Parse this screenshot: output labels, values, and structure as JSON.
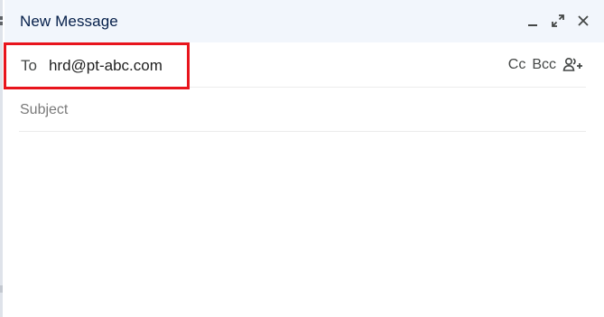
{
  "compose": {
    "title": "New Message",
    "to_label": "To",
    "to_value": "hrd@pt-abc.com",
    "cc_label": "Cc",
    "bcc_label": "Bcc",
    "subject_placeholder": "Subject",
    "body_text": ""
  },
  "icons": {
    "minimize": "minimize-icon",
    "expand": "expand-icon",
    "close": "close-icon",
    "add_recipients": "add-contacts-icon"
  },
  "colors": {
    "header_bg": "#f2f6fc",
    "title": "#041e49",
    "highlight_border": "#e8141c",
    "divider": "#ececec"
  }
}
